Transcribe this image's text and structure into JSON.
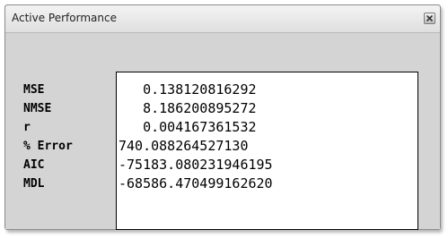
{
  "window": {
    "title": "Active Performance"
  },
  "close_button": {
    "icon": "close-icon"
  },
  "metrics": [
    {
      "label": "MSE",
      "value": "   0.138120816292"
    },
    {
      "label": "NMSE",
      "value": "   8.186200895272"
    },
    {
      "label": "r",
      "value": "   0.004167361532"
    },
    {
      "label": "% Error",
      "value": "740.088264527130"
    },
    {
      "label": "AIC",
      "value": "-75183.080231946195"
    },
    {
      "label": "MDL",
      "value": "-68586.470499162620"
    }
  ]
}
